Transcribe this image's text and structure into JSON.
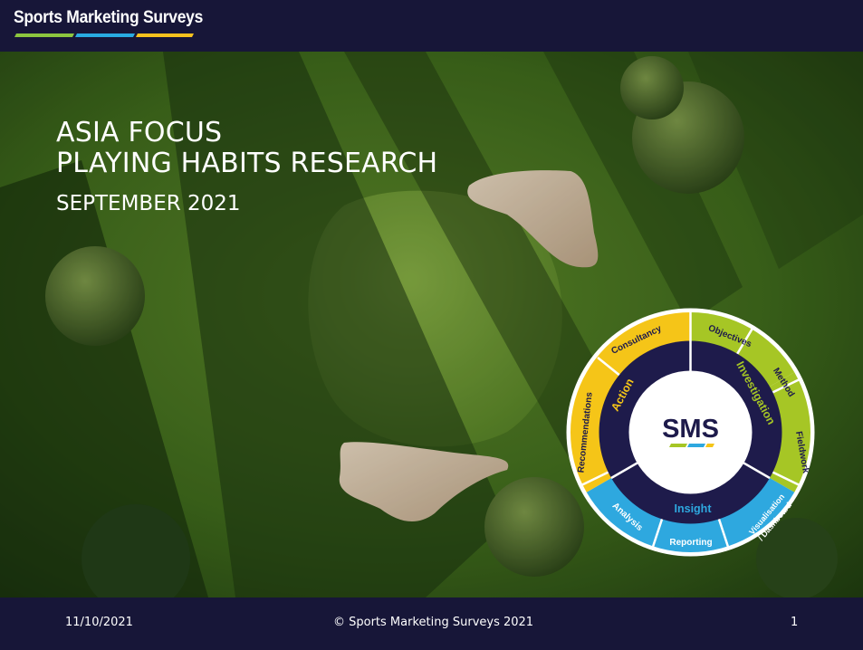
{
  "header": {
    "brand": "Sports Marketing Surveys",
    "stripe_colors": [
      "#8dc63f",
      "#29abe2",
      "#f7c21e"
    ]
  },
  "slide": {
    "title_line1": "ASIA FOCUS",
    "title_line2": "PLAYING HABITS RESEARCH",
    "date": "SEPTEMBER 2021"
  },
  "wheel": {
    "center": "SMS",
    "phases": {
      "investigation": "Investigation",
      "insight": "Insight",
      "action": "Action"
    },
    "outer": {
      "objectives": "Objectives",
      "method": "Method",
      "fieldwork": "Fieldwork",
      "visualisation_line1": "Visualisation",
      "visualisation_line2": "/ Dashboard",
      "reporting": "Reporting",
      "analysis": "Analysis",
      "recommendations": "Recommendations",
      "consultancy": "Consultancy"
    },
    "colors": {
      "green": "#a6c625",
      "blue": "#2ea8df",
      "yellow": "#f5c518",
      "navy": "#1e1b4b"
    }
  },
  "footer": {
    "date": "11/10/2021",
    "copyright": "© Sports Marketing Surveys 2021",
    "page_number": "1"
  }
}
